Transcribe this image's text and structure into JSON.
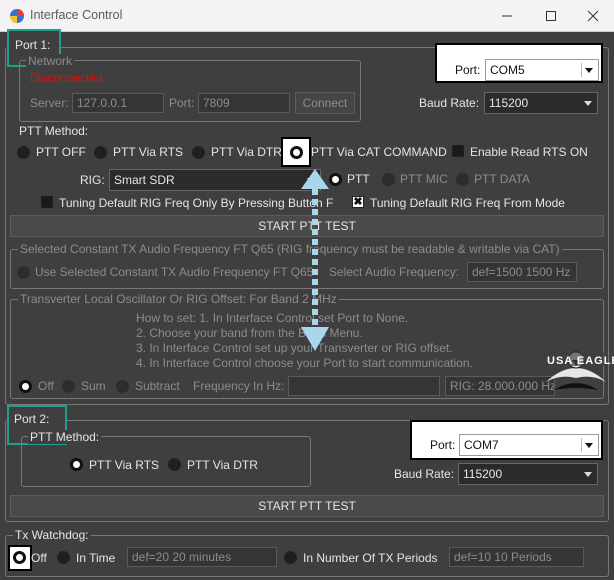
{
  "window": {
    "title": "Interface Control"
  },
  "port1": {
    "label": "Port 1:",
    "network": {
      "label": "Network",
      "status": "Disconnected",
      "server_label": "Server:",
      "server_value": "127.0.0.1",
      "port_label": "Port:",
      "port_value": "7809",
      "connect_label": "Connect"
    },
    "port_label": "Port:",
    "port_value": "COM5",
    "baud_label": "Baud Rate:",
    "baud_value": "115200",
    "ptt_method_label": "PTT Method:",
    "ptt_options": [
      "PTT OFF",
      "PTT Via RTS",
      "PTT Via DTR",
      "PTT Via CAT COMMAND"
    ],
    "enable_rts_label": "Enable Read RTS ON",
    "rig_label": "RIG:",
    "rig_value": "Smart SDR",
    "rig_modes": [
      "PTT",
      "PTT MIC",
      "PTT DATA"
    ],
    "tune_band_label": "Tuning Default RIG Freq Only By Pressing Button F",
    "tune_mode_label": "Tuning Default RIG Freq From Mode",
    "start_ptt_label": "START PTT TEST",
    "const_tx": {
      "label": "Selected Constant TX  Audio Frequency FT Q65 (RIG frequency must be readable & writable via CAT)",
      "use_label": "Use Selected Constant TX  Audio Frequency FT Q65",
      "select_label": "Select  Audio Frequency:",
      "value": "def=1500  1500  Hz"
    },
    "transverter": {
      "label": "Transverter Local Oscillator Or RIG Offset:  For Band 2 MHz",
      "instructions": [
        "How to set: 1. In Interface Control set Port to None.",
        "2. Choose your band from the Band Menu.",
        "3. In Interface Control set up your Transverter or RIG offset.",
        "4. In Interface Control choose your Port to start communication."
      ],
      "options": [
        "Off",
        "Sum",
        "Subtract"
      ],
      "freq_label": "Frequency In Hz:",
      "freq_value": "",
      "rig_value": "RIG: 28.000.000  Hz"
    }
  },
  "port2": {
    "label": "Port 2:",
    "ptt_method_label": "PTT Method:",
    "ptt_options": [
      "PTT Via RTS",
      "PTT Via DTR"
    ],
    "port_label": "Port:",
    "port_value": "COM7",
    "baud_label": "Baud Rate:",
    "baud_value": "115200",
    "start_ptt_label": "START PTT TEST"
  },
  "watchdog": {
    "label": "Tx Watchdog:",
    "off_label": "Off",
    "in_time_label": "In Time",
    "time_value": "def=20  20  minutes",
    "periods_label": "In Number Of TX Periods",
    "periods_value": "def=10  10  Periods"
  },
  "logo": {
    "text": "USA EAGLE"
  },
  "colors": {
    "highlight": "#1aa38a",
    "accent_arrow": "#a9d6ea",
    "status_red": "#e01010"
  }
}
